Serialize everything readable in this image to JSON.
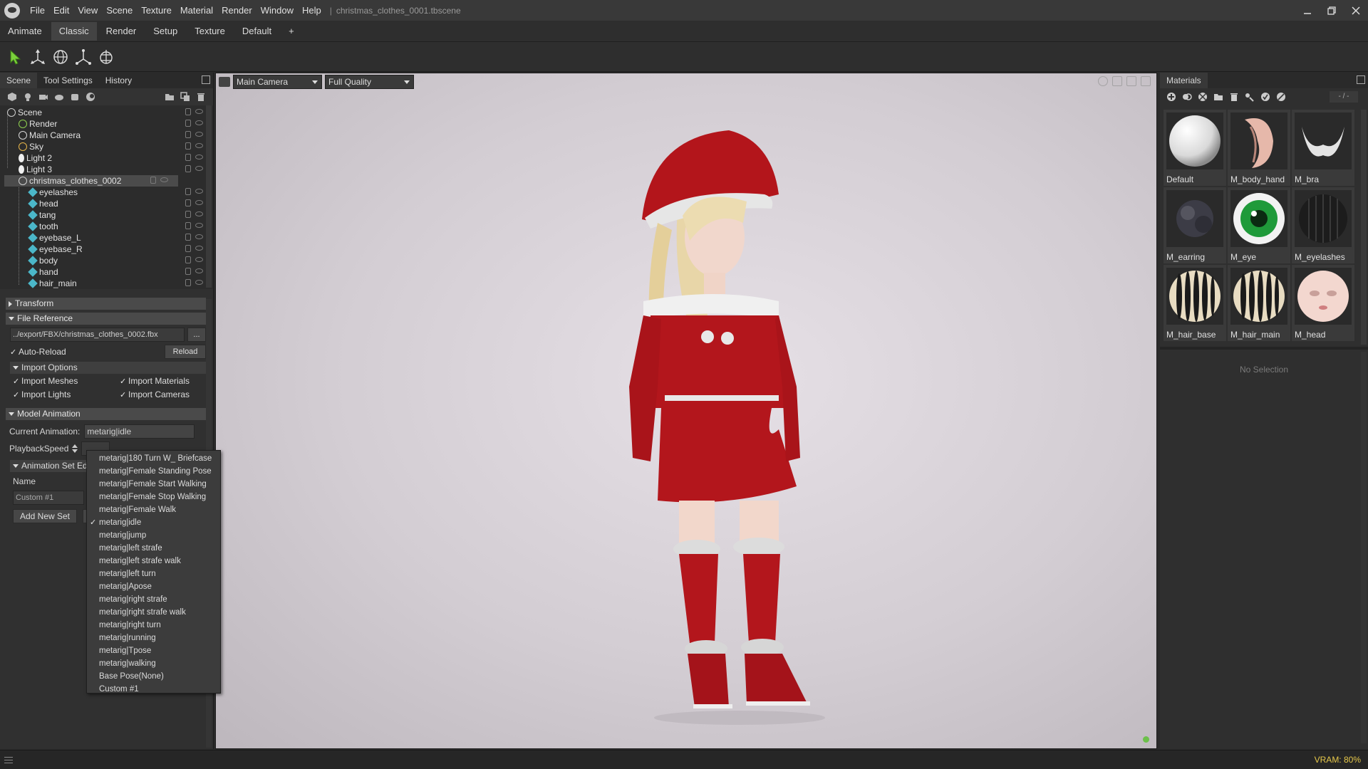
{
  "menu": {
    "items": [
      "File",
      "Edit",
      "View",
      "Scene",
      "Texture",
      "Material",
      "Render",
      "Window",
      "Help"
    ],
    "separator": "|",
    "window_title": "christmas_clothes_0001.tbscene"
  },
  "workspace_tabs": [
    {
      "label": "Animate",
      "active": false
    },
    {
      "label": "Classic",
      "active": true
    },
    {
      "label": "Render",
      "active": false
    },
    {
      "label": "Setup",
      "active": false
    },
    {
      "label": "Texture",
      "active": false
    },
    {
      "label": "Default",
      "active": false
    },
    {
      "label": "+",
      "active": false
    }
  ],
  "toolbar": {
    "tools": [
      "select-arrow-icon",
      "move-gizmo-icon",
      "rotate-gizmo-icon",
      "scale-gizmo-icon",
      "transform-gizmo-icon"
    ]
  },
  "left_panel": {
    "tabs": [
      "Scene",
      "Tool Settings",
      "History"
    ],
    "scene_tree": [
      {
        "label": "Scene",
        "icon": "scene-icon"
      },
      {
        "label": "Render",
        "icon": "render-gear-icon"
      },
      {
        "label": "Main Camera",
        "icon": "camera-icon"
      },
      {
        "label": "Sky",
        "icon": "sky-icon"
      },
      {
        "label": "Light 2",
        "icon": "light-icon"
      },
      {
        "label": "Light 3",
        "icon": "light-icon"
      },
      {
        "label": "christmas_clothes_0002",
        "icon": "model-icon",
        "selected": true
      },
      {
        "label": "eyelashes",
        "icon": "mesh-icon"
      },
      {
        "label": "head",
        "icon": "mesh-icon"
      },
      {
        "label": "tang",
        "icon": "mesh-icon"
      },
      {
        "label": "tooth",
        "icon": "mesh-icon"
      },
      {
        "label": "eyebase_L",
        "icon": "mesh-icon"
      },
      {
        "label": "eyebase_R",
        "icon": "mesh-icon"
      },
      {
        "label": "body",
        "icon": "mesh-icon"
      },
      {
        "label": "hand",
        "icon": "mesh-icon"
      },
      {
        "label": "hair_main",
        "icon": "mesh-icon"
      }
    ],
    "transform_header": "Transform",
    "file_reference": {
      "header": "File Reference",
      "path": "../export/FBX/christmas_clothes_0002.fbx",
      "browse": "...",
      "auto_reload": "Auto-Reload",
      "reload": "Reload",
      "import_options_header": "Import Options",
      "import_meshes": "Import Meshes",
      "import_materials": "Import Materials",
      "import_lights": "Import Lights",
      "import_cameras": "Import Cameras"
    },
    "model_animation": {
      "header": "Model Animation",
      "current_label": "Current Animation:",
      "current_value": "metarig|idle",
      "playback_label": "PlaybackSpeed",
      "anim_set_header": "Animation Set Ed",
      "name_label": "Name",
      "custom_name": "Custom #1",
      "add_new_set": "Add New Set"
    }
  },
  "animation_dropdown": {
    "items": [
      "metarig|180 Turn W_ Briefcase",
      "metarig|Female Standing Pose",
      "metarig|Female Start Walking",
      "metarig|Female Stop Walking",
      "metarig|Female Walk",
      "metarig|idle",
      "metarig|jump",
      "metarig|left strafe",
      "metarig|left strafe walk",
      "metarig|left turn",
      "metarig|Apose",
      "metarig|right strafe",
      "metarig|right strafe walk",
      "metarig|right turn",
      "metarig|running",
      "metarig|Tpose",
      "metarig|walking",
      "Base Pose(None)",
      "Custom #1"
    ],
    "selected": "metarig|idle"
  },
  "viewport": {
    "camera": "Main Camera",
    "quality": "Full Quality"
  },
  "materials": {
    "title": "Materials",
    "counter": "- / -",
    "items": [
      {
        "label": "Default",
        "thumb": "sphere-white"
      },
      {
        "label": "M_body_hand",
        "thumb": "body-hand"
      },
      {
        "label": "M_bra",
        "thumb": "bra"
      },
      {
        "label": "M_earring",
        "thumb": "earring"
      },
      {
        "label": "M_eye",
        "thumb": "eye"
      },
      {
        "label": "M_eyelashes",
        "thumb": "eyelashes"
      },
      {
        "label": "M_hair_base",
        "thumb": "hair-striped"
      },
      {
        "label": "M_hair_main",
        "thumb": "hair-striped"
      },
      {
        "label": "M_head",
        "thumb": "head-face"
      }
    ],
    "no_selection": "No Selection"
  },
  "status": {
    "vram": "VRAM: 80%"
  }
}
